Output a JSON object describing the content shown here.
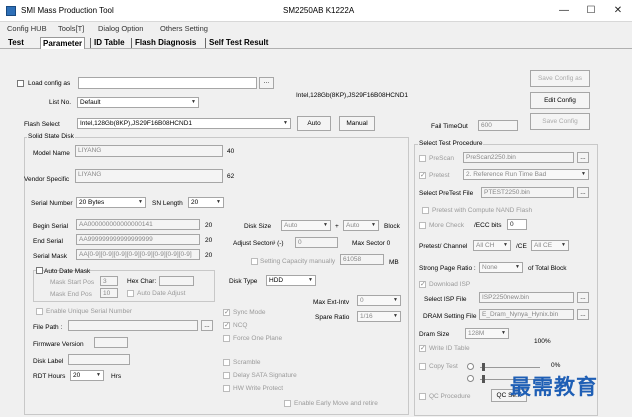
{
  "window": {
    "title": "SMI Mass Production Tool",
    "model": "SM2250AB  K1222A",
    "minimize": "—",
    "maximize": "☐",
    "close": "✕"
  },
  "menu": [
    "Config HUB",
    "Tools[T]",
    "Dialog Option",
    "Others Setting"
  ],
  "tabs": [
    "Test",
    "Parameter",
    "ID Table",
    "Flash Diagnosis",
    "Self Test Result"
  ],
  "config": {
    "load_config_label": "Load config as",
    "load_config_value": "",
    "browse_label": "...",
    "list_no_label": "List No.",
    "list_no_value": "Default",
    "flash_info_text": "Intel,128Gb(8KP),JS29F16B08HCND1",
    "flash_select_label": "Flash Select",
    "flash_select_value": "Intel,128Gb(8KP),JS29F16B08HCND1",
    "auto_label": "Auto",
    "manual_label": "Manual",
    "save_config_as": "Save Config as",
    "edit_config": "Edit Config",
    "save_config": "Save Config",
    "fail_timeout_label": "Fail TimeOut",
    "fail_timeout_value": "600"
  },
  "ssd": {
    "group_label": "Solid State Disk",
    "model_name_label": "Model Name",
    "model_name_value": "LIYANG",
    "model_name_len": "40",
    "vendor_label": "Vendor Specific",
    "vendor_value": "LIYANG",
    "vendor_len": "62",
    "serial_number_label": "Serial Number",
    "serial_number_value": "20 Bytes",
    "sn_length_label": "SN Length",
    "sn_length_value": "20",
    "begin_serial_label": "Begin Serial",
    "begin_serial_value": "AA000000000000000141",
    "begin_serial_len": "20",
    "end_serial_label": "End Serial",
    "end_serial_value": "AA999999999999999999",
    "end_serial_len": "20",
    "serial_mask_label": "Serial Mask",
    "serial_mask_value": "AA[0-9][0-9][0-9][0-9][0-9][0-9][0-9][0-9]",
    "serial_mask_len": "20",
    "auto_date_mask_label": "Auto Date Mask",
    "mask_start_pos_label": "Mask Start Pos",
    "mask_start_pos_value": "3",
    "hex_char_label": "Hex Char:",
    "mask_end_pos_label": "Mask End Pos",
    "mask_end_pos_value": "10",
    "auto_date_adjust_label": "Auto Date Adjust",
    "enable_unique_serial_label": "Enable Unique Serial Number",
    "file_path_label": "File Path :",
    "firmware_version_label": "Firmware Version",
    "disk_label_label": "Disk Label",
    "rdt_hours_label": "RDT Hours",
    "rdt_hours_value": "20",
    "hrs_label": "Hrs",
    "disk_size_label": "Disk Size",
    "disk_size_value": "Auto",
    "plus": "+",
    "disk_size_value2": "Auto",
    "block_label": "Block",
    "adjust_sector_label": "Adjust Sector# (-)",
    "adjust_sector_value": "0",
    "max_sector_label": "Max Sector 0",
    "setting_capacity_label": "Setting Capacity manually",
    "setting_capacity_value": "61058",
    "mb_label": "MB",
    "disk_type_label": "Disk Type",
    "disk_type_value": "HDD",
    "max_ext_intv_label": "Max Ext-Intv",
    "max_ext_intv_value": "0",
    "spare_ratio_label": "Spare Ratio",
    "spare_ratio_value": "1/16",
    "sync_mode_label": "Sync Mode",
    "ncq_label": "NCQ",
    "force_one_plane_label": "Force One Plane",
    "scramble_label": "Scramble",
    "delay_sata_label": "Delay SATA Signature",
    "hw_write_protect_label": "HW Write Protect",
    "enable_early_move_label": "Enable Early Move and retire"
  },
  "procedure": {
    "group_label": "Select Test Procedure",
    "prescan_label": "PreScan",
    "prescan_value": "PreScan2250.bin",
    "pretest_label": "Pretest",
    "pretest_value": "2. Reference Run Time Bad",
    "select_pretest_label": "Select PreTest File",
    "select_pretest_value": "PTEST2250.bin",
    "pretest_nand_label": "Pretest with Compute NAND Flash",
    "more_check_label": "More Check",
    "ecc_bits_label": "/ECC bits",
    "ecc_bits_value": "0",
    "pretest_channel_label": "Pretest/ Channel",
    "channel_value": "All CH",
    "ce_label": "/CE",
    "ce_value": "All CE",
    "strong_page_label": "Strong Page Ratio :",
    "strong_page_value": "None",
    "of_total_label": "of Total Block",
    "download_isp_label": "Download ISP",
    "select_isp_label": "Select ISP File",
    "select_isp_value": "ISP2250new.bin",
    "dram_setting_label": "DRAM Setting File",
    "dram_setting_value": "E_Dram_Nynya_Hynix.bin",
    "dram_size_label": "Dram Size",
    "dram_size_value": "128M",
    "percent_label": "100%",
    "write_id_label": "Write ID Table",
    "copy_test_label": "Copy Test",
    "copy_percent": "0%",
    "qc_procedure_label": "QC Procedure",
    "qc_button": "QC Se..."
  },
  "watermark": "最需教育",
  "colors": {
    "accent": "#2d6fb7",
    "watermark": "#1f5fb5",
    "background": "#f0f0f0"
  }
}
